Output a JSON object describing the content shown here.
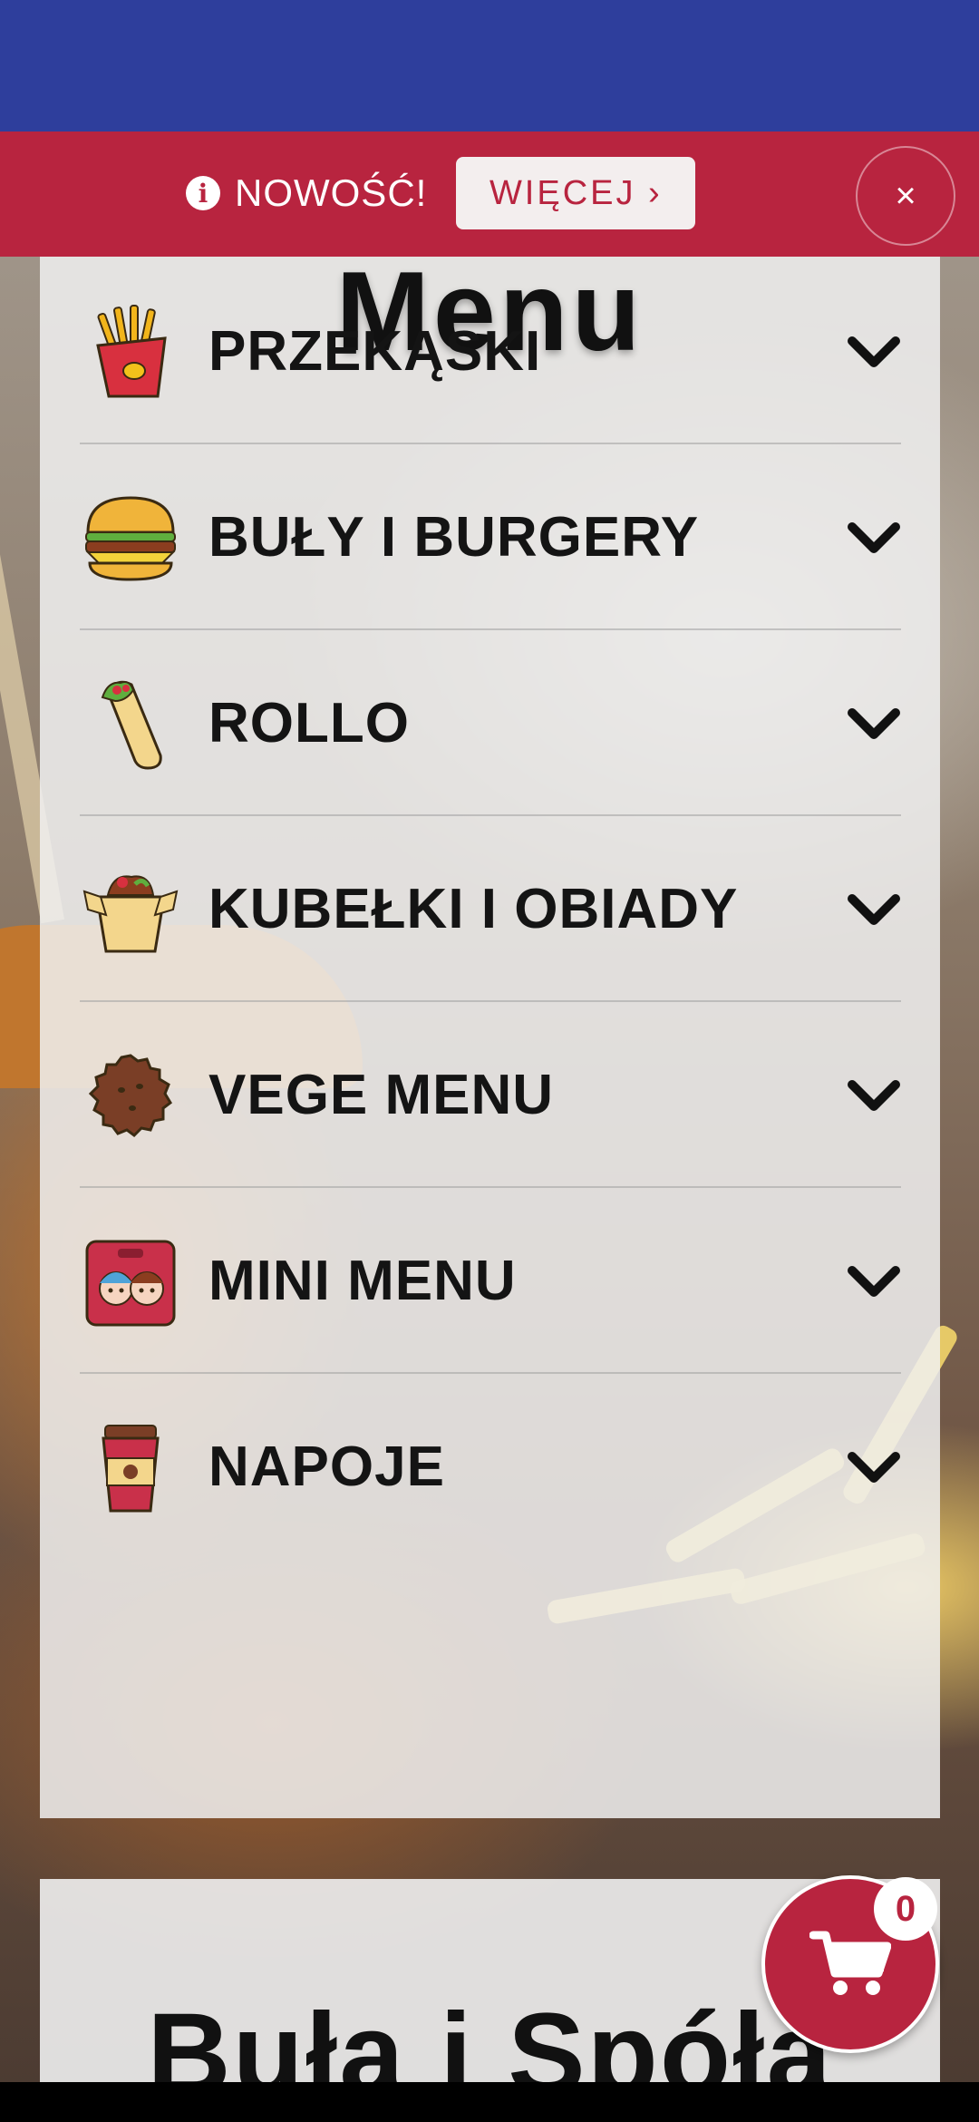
{
  "notice": {
    "text": "NOWOŚĆ!",
    "more_label": "WIĘCEJ ›",
    "close_label": "×",
    "info_glyph": "i"
  },
  "menu": {
    "title": "Menu",
    "items": [
      {
        "label": "PRZEKĄSKI",
        "icon": "fries-icon"
      },
      {
        "label": "BUŁY I BURGERY",
        "icon": "burger-icon"
      },
      {
        "label": "ROLLO",
        "icon": "wrap-icon"
      },
      {
        "label": "KUBEŁKI I OBIADY",
        "icon": "takeout-box-icon"
      },
      {
        "label": "VEGE MENU",
        "icon": "falafel-icon"
      },
      {
        "label": "MINI MENU",
        "icon": "kids-box-icon"
      },
      {
        "label": "NAPOJE",
        "icon": "drink-cup-icon"
      }
    ]
  },
  "about": {
    "title": "Buła i Spółą"
  },
  "cart": {
    "count": "0"
  },
  "colors": {
    "header_blue": "#2e3e9c",
    "accent_red": "#b8243f"
  }
}
